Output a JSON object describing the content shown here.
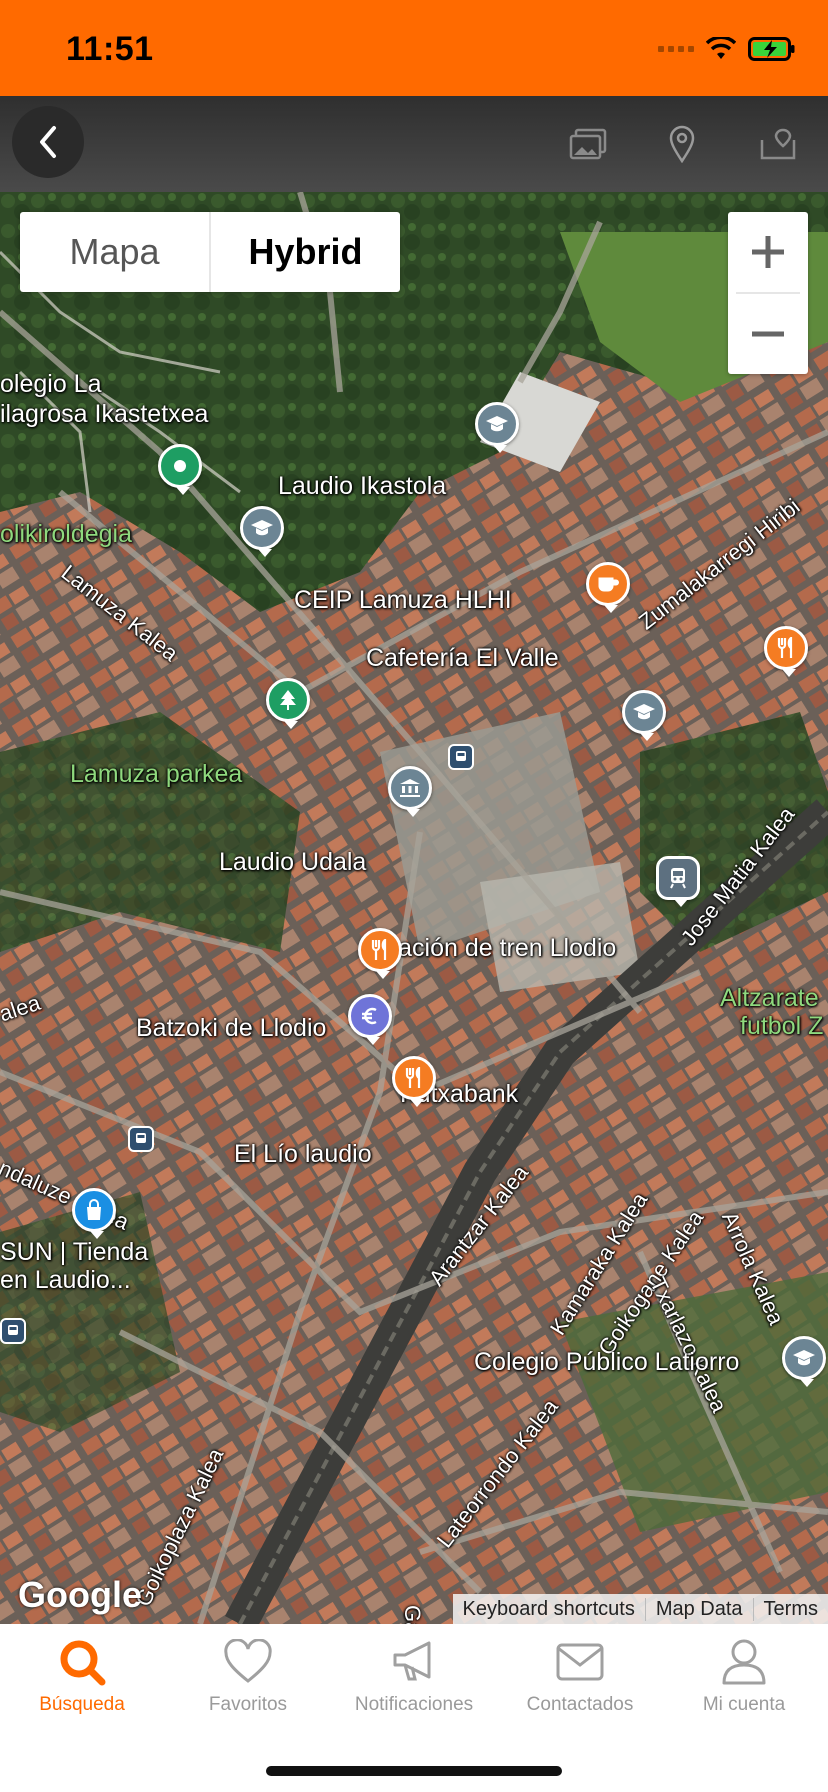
{
  "status_bar": {
    "time": "11:51"
  },
  "toolbar": {
    "back_icon": "chevron-left-icon",
    "icons": [
      "gallery-icon",
      "location-pin-icon",
      "map-icon"
    ]
  },
  "map": {
    "type_control": {
      "map_label": "Mapa",
      "hybrid_label": "Hybrid",
      "selected": "Hybrid"
    },
    "zoom": {
      "in_label": "+",
      "out_label": "−"
    },
    "labels": {
      "colegio": "olegio La",
      "milagrosa": "ilagrosa Ikastetxea",
      "laudio_ikastola": "Laudio Ikastola",
      "polikiroldegia": "olikiroldegia",
      "lamuza_kalea": "Lamuza Kalea",
      "ceip": "CEIP Lamuza HLHI",
      "zumalakarregi": "Zumalakarregi Hiribi",
      "cafeteria": "Cafetería El Valle",
      "lamuza_parkea": "Lamuza parkea",
      "laudio_udala": "Laudio Udala",
      "jose_matia": "Jose Matia Kalea",
      "estacion": "Estación de tren Llodio",
      "kalea_left": "alea",
      "altzarate_1": "Altzarate",
      "altzarate_2": "futbol Z",
      "batzoki": "Batzoki de Llodio",
      "kutxabank": "Kutxabank",
      "el_lio": "El Lío laudio",
      "andaluze": "ndaluze Kalea",
      "arantzar": "Arantzar Kalea",
      "kamaraka": "Kamaraka Kalea",
      "goikogane": "Goikogane Kalea",
      "arrola": "Arrola Kalea",
      "txarlazo": "Txarlazo Kalea",
      "sun_1": "SUN | Tienda",
      "sun_2": "en Laudio...",
      "goikoplaza": "Goikoplaza Kalea",
      "lateorrondo": "Lateorrondo Kalea",
      "colegio_latiorro": "Colegio Público Latiorro",
      "gall": "Gall"
    },
    "google_logo": "Google",
    "attribution": {
      "shortcuts": "Keyboard shortcuts",
      "data": "Map Data",
      "terms": "Terms"
    },
    "colors": {
      "restaurant": "#f57c22",
      "school": "#6c8594",
      "park": "#1e9e63",
      "bank": "#6f74d8",
      "shop": "#1a8fe3",
      "transit": "#5d7080"
    }
  },
  "tab_bar": {
    "accent": "#ff6a00",
    "tabs": [
      {
        "label": "Búsqueda",
        "icon": "search-icon",
        "active": true
      },
      {
        "label": "Favoritos",
        "icon": "heart-icon",
        "active": false
      },
      {
        "label": "Notificaciones",
        "icon": "megaphone-icon",
        "active": false
      },
      {
        "label": "Contactados",
        "icon": "mail-icon",
        "active": false
      },
      {
        "label": "Mi cuenta",
        "icon": "user-icon",
        "active": false
      }
    ]
  }
}
